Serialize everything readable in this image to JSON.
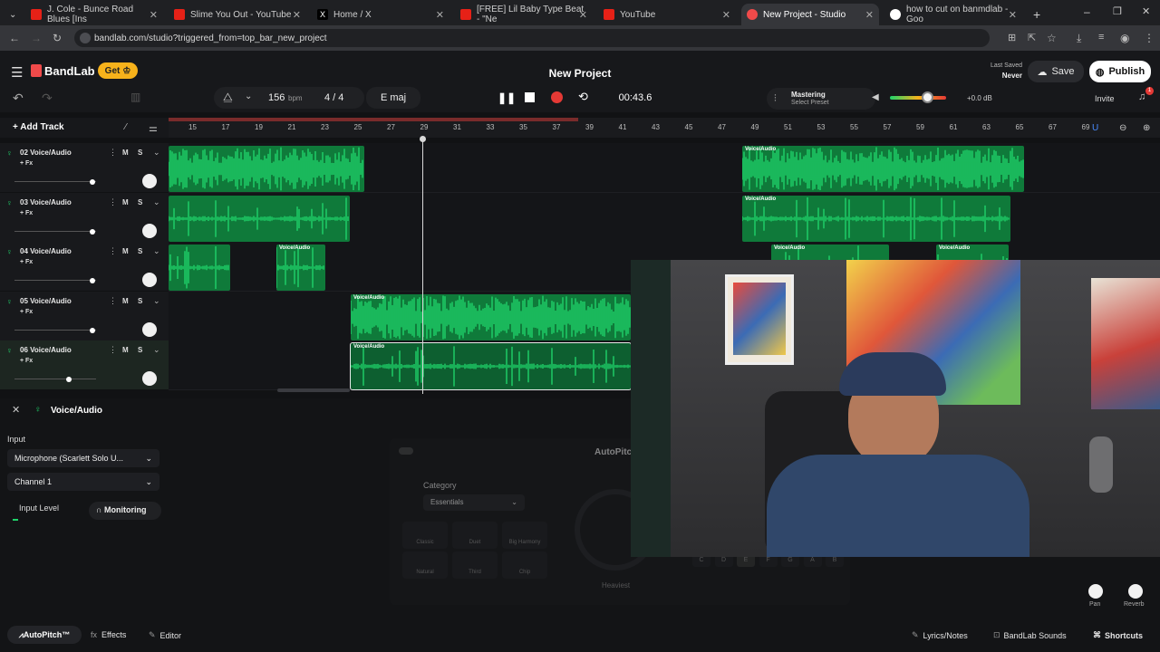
{
  "browser": {
    "tabs": [
      {
        "title": "J. Cole - Bunce Road Blues [Ins",
        "color": "#e62117"
      },
      {
        "title": "Slime You Out - YouTube",
        "color": "#e62117"
      },
      {
        "title": "Home / X",
        "color": "#000000"
      },
      {
        "title": "[FREE] Lil Baby Type Beat - \"Ne",
        "color": "#e62117"
      },
      {
        "title": "YouTube",
        "color": "#e62117"
      },
      {
        "title": "New Project - Studio",
        "color": "#f04a4a"
      },
      {
        "title": "how to cut on banmdlab - Goo",
        "color": "#4285f4"
      }
    ],
    "url": "bandlab.com/studio?triggered_from=top_bar_new_project"
  },
  "header": {
    "brand": "BandLab",
    "get_label": "Get",
    "project_title": "New Project",
    "last_saved_label": "Last Saved",
    "last_saved_value": "Never",
    "save_label": "Save",
    "publish_label": "Publish",
    "bpm_value": "156",
    "bpm_unit": "bpm",
    "time_signature": "4 / 4",
    "key": "E maj",
    "time": "00:43.6",
    "mastering_label": "Mastering",
    "mastering_preset": "Select Preset",
    "volume_db": "+0.0 dB",
    "invite_label": "Invite",
    "notification_count": "1"
  },
  "toolbar": {
    "add_track": "Add Track"
  },
  "ruler": [
    "15",
    "17",
    "19",
    "21",
    "23",
    "25",
    "27",
    "29",
    "31",
    "33",
    "35",
    "37",
    "39",
    "41",
    "43",
    "45",
    "47",
    "49",
    "51",
    "53",
    "55",
    "57",
    "59",
    "61",
    "63",
    "65",
    "67",
    "69"
  ],
  "tracks": [
    {
      "name": "02 Voice/Audio",
      "fx": "+ Fx",
      "mute": "M",
      "solo": "S"
    },
    {
      "name": "03 Voice/Audio",
      "fx": "+ Fx",
      "mute": "M",
      "solo": "S"
    },
    {
      "name": "04 Voice/Audio",
      "fx": "+ Fx",
      "mute": "M",
      "solo": "S"
    },
    {
      "name": "05 Voice/Audio",
      "fx": "+ Fx",
      "mute": "M",
      "solo": "S"
    },
    {
      "name": "06 Voice/Audio",
      "fx": "+ Fx",
      "mute": "M",
      "solo": "S"
    }
  ],
  "clip_label": "Voice/Audio",
  "panel": {
    "title": "Voice/Audio",
    "input_label": "Input",
    "input_device": "Microphone (Scarlett Solo U...",
    "channel": "Channel 1",
    "input_level_label": "Input Level",
    "monitoring_label": "Monitoring",
    "autopitch_title": "AutoPitch",
    "category_label": "Category",
    "category_value": "Essentials",
    "presets": [
      "Classic",
      "Duet",
      "Big Harmony",
      "Natural",
      "Third",
      "Chip"
    ],
    "keys": [
      "C",
      "D",
      "E",
      "F",
      "G",
      "A",
      "B"
    ],
    "heaviest_label": "Heaviest",
    "pan_label": "Pan",
    "reverb_label": "Reverb"
  },
  "footer": {
    "autopitch": "AutoPitch™",
    "effects": "Effects",
    "editor": "Editor",
    "lyrics": "Lyrics/Notes",
    "sounds": "BandLab Sounds",
    "shortcuts": "Shortcuts"
  },
  "colors": {
    "accent": "#f04a4a",
    "wave": "#1fd36a",
    "clip": "#0f7a3a",
    "record": "#e53935",
    "get": "#f7b21b"
  }
}
